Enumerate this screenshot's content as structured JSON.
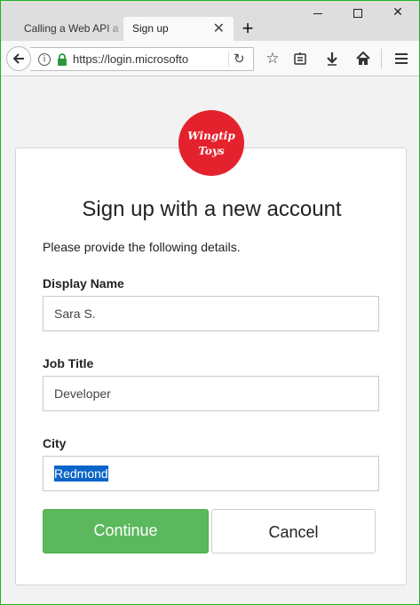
{
  "browser": {
    "tabs": [
      {
        "label": "Calling a Web API a",
        "active": false
      },
      {
        "label": "Sign up",
        "active": true
      }
    ],
    "url": "https://login.microsofto"
  },
  "form": {
    "logo_line1": "Wingtip",
    "logo_line2": "Toys",
    "heading": "Sign up with a new account",
    "intro": "Please provide the following details.",
    "fields": [
      {
        "label": "Display Name",
        "value": "Sara S."
      },
      {
        "label": "Job Title",
        "value": "Developer"
      },
      {
        "label": "City",
        "value": "Redmond"
      }
    ],
    "continue_label": "Continue",
    "cancel_label": "Cancel"
  },
  "colors": {
    "logo": "#e4222d",
    "continue": "#5cb85c",
    "selection": "#0a64c8",
    "window_border": "#1fb31f"
  }
}
